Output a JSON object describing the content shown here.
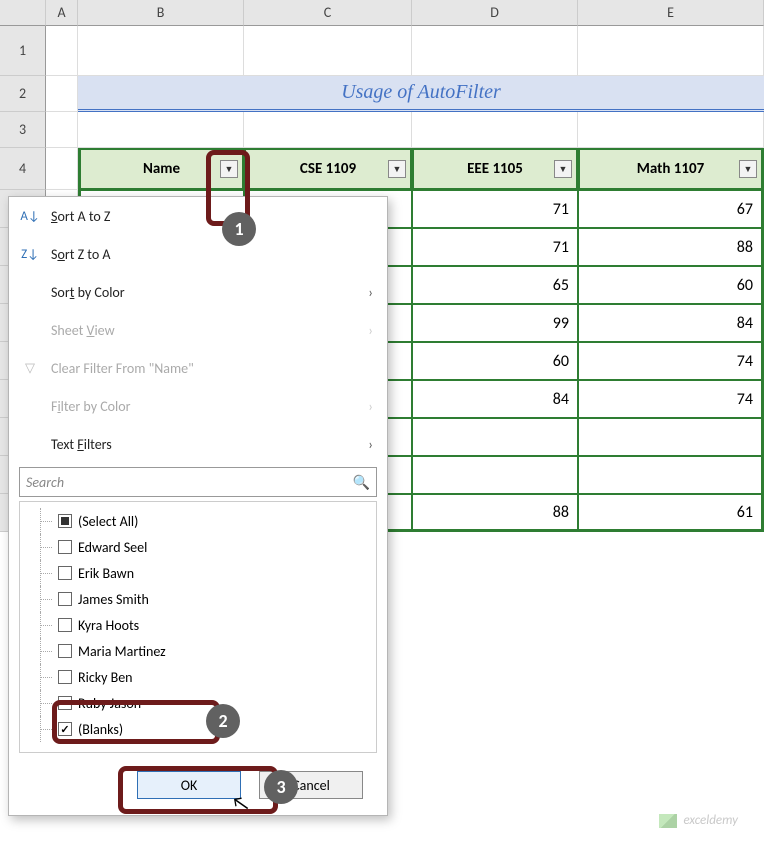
{
  "columns": {
    "A": "A",
    "B": "B",
    "C": "C",
    "D": "D",
    "E": "E"
  },
  "row_labels": [
    "1",
    "2",
    "3",
    "4"
  ],
  "title": "Usage of AutoFilter",
  "table": {
    "headers": {
      "name": "Name",
      "cse": "CSE 1109",
      "eee": "EEE 1105",
      "math": "Math 1107"
    },
    "rows": [
      {
        "eee": "71",
        "math": "67"
      },
      {
        "eee": "71",
        "math": "88"
      },
      {
        "eee": "65",
        "math": "60"
      },
      {
        "eee": "99",
        "math": "84"
      },
      {
        "eee": "60",
        "math": "74"
      },
      {
        "eee": "84",
        "math": "74"
      },
      {
        "eee": "",
        "math": ""
      },
      {
        "eee": "",
        "math": ""
      },
      {
        "eee": "88",
        "math": "61"
      }
    ]
  },
  "filter_menu": {
    "sort_az": "Sort A to Z",
    "sort_za": "Sort Z to A",
    "sort_color": "Sort by Color",
    "sheet_view": "Sheet View",
    "clear": "Clear Filter From \"Name\"",
    "filter_color": "Filter by Color",
    "text_filters": "Text Filters",
    "search_placeholder": "Search",
    "items": [
      {
        "label": "(Select All)",
        "state": "indet"
      },
      {
        "label": "Edward Seel",
        "state": "unchecked"
      },
      {
        "label": "Erik Bawn",
        "state": "unchecked"
      },
      {
        "label": "James Smith",
        "state": "unchecked"
      },
      {
        "label": "Kyra Hoots",
        "state": "unchecked"
      },
      {
        "label": "Maria Martinez",
        "state": "unchecked"
      },
      {
        "label": "Ricky Ben",
        "state": "unchecked"
      },
      {
        "label": "Ruby Jason",
        "state": "unchecked"
      },
      {
        "label": "(Blanks)",
        "state": "checked"
      }
    ],
    "ok": "OK",
    "cancel": "Cancel"
  },
  "badges": {
    "b1": "1",
    "b2": "2",
    "b3": "3"
  },
  "watermark": "exceldemy",
  "chart_data": {
    "type": "table",
    "title": "Usage of AutoFilter",
    "columns": [
      "Name",
      "CSE 1109",
      "EEE 1105",
      "Math 1107"
    ],
    "visible_columns": [
      "EEE 1105",
      "Math 1107"
    ],
    "rows": [
      {
        "EEE 1105": 71,
        "Math 1107": 67
      },
      {
        "EEE 1105": 71,
        "Math 1107": 88
      },
      {
        "EEE 1105": 65,
        "Math 1107": 60
      },
      {
        "EEE 1105": 99,
        "Math 1107": 84
      },
      {
        "EEE 1105": 60,
        "Math 1107": 74
      },
      {
        "EEE 1105": 84,
        "Math 1107": 74
      },
      {
        "EEE 1105": null,
        "Math 1107": null
      },
      {
        "EEE 1105": null,
        "Math 1107": null
      },
      {
        "EEE 1105": 88,
        "Math 1107": 61
      }
    ],
    "filter_on_column": "Name",
    "filter_checked": [
      "(Blanks)"
    ],
    "filter_unchecked": [
      "Edward Seel",
      "Erik Bawn",
      "James Smith",
      "Kyra Hoots",
      "Maria Martinez",
      "Ricky Ben",
      "Ruby Jason"
    ]
  }
}
